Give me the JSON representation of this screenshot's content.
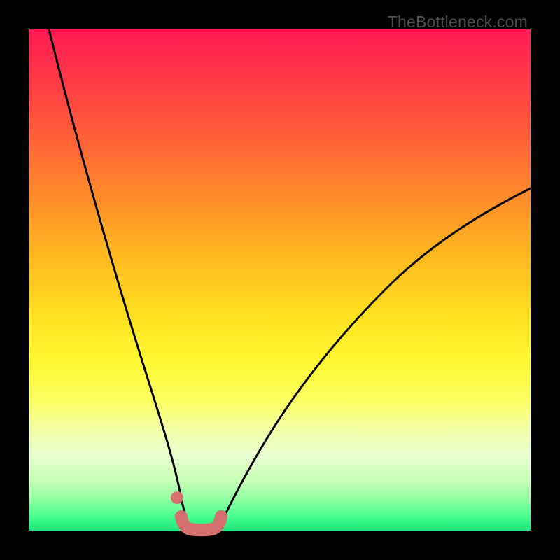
{
  "watermark": "TheBottleneck.com",
  "chart_data": {
    "type": "line",
    "title": "",
    "xlabel": "",
    "ylabel": "",
    "xlim": [
      0,
      100
    ],
    "ylim": [
      0,
      100
    ],
    "grid": false,
    "series": [
      {
        "name": "left-curve",
        "x": [
          4,
          8,
          12,
          16,
          20,
          23,
          26,
          28,
          30,
          31
        ],
        "y": [
          100,
          83,
          66,
          50,
          34,
          22,
          12,
          5,
          1,
          0
        ]
      },
      {
        "name": "right-curve",
        "x": [
          37,
          40,
          45,
          50,
          55,
          60,
          66,
          74,
          84,
          96,
          100
        ],
        "y": [
          0,
          2,
          8,
          15,
          23,
          31,
          39,
          48,
          57,
          65,
          68
        ]
      },
      {
        "name": "bottom-marker",
        "x": [
          30.3,
          30.6,
          31.2,
          32.0,
          33.0,
          34.0,
          35.0,
          36.0,
          36.8,
          37.4,
          37.7
        ],
        "y": [
          2.8,
          1.5,
          0.7,
          0.3,
          0.2,
          0.2,
          0.2,
          0.3,
          0.6,
          1.4,
          2.8
        ]
      },
      {
        "name": "stray-dot",
        "x": [
          29.5
        ],
        "y": [
          6.6
        ]
      }
    ],
    "colors": {
      "curve": "#000000",
      "marker": "#d6706e",
      "dot": "#d6706e"
    }
  }
}
